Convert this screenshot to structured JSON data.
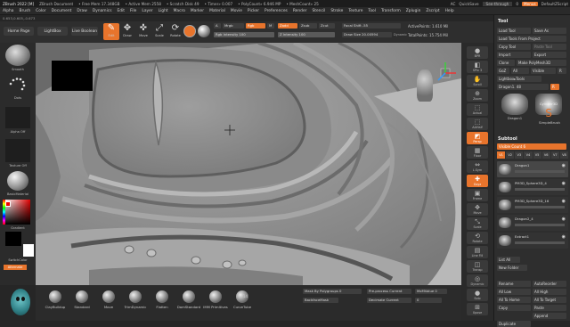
{
  "titlebar": {
    "app": "ZBrush 2022 [M]",
    "doc": "ZBrush Document",
    "free_mem": "• Free Mem 17.348GB",
    "active_mem": "• Active Mem 2558",
    "scratch": "• Scratch Disk 49",
    "timer": "• Timer» 0.007",
    "polycount": "• PolyCount» 6.946 MP",
    "meshcount": "• MeshCount» 25",
    "right": [
      "AC",
      "QuickSave",
      "See-through",
      "0",
      "Menus",
      "DefaultZScript"
    ]
  },
  "menubar": [
    "Alpha",
    "Brush",
    "Color",
    "Document",
    "Draw",
    "Dynamics",
    "Edit",
    "File",
    "Layer",
    "Light",
    "Macro",
    "Marker",
    "Material",
    "Movie",
    "Picker",
    "Preferences",
    "Render",
    "Stencil",
    "Stroke",
    "Texture",
    "Tool",
    "Transform",
    "Zplugin",
    "Zscript",
    "Help"
  ],
  "stats": "0.653,0.605,-0.673",
  "homebar": {
    "home_page": "Home Page",
    "lightbox": "LightBox",
    "live_boolean": "Live Boolean",
    "tools": [
      {
        "label": "Edit",
        "icon": "✎",
        "active": true
      },
      {
        "label": "Draw",
        "icon": "✥",
        "active": false
      },
      {
        "label": "Move",
        "icon": "✜",
        "active": false
      },
      {
        "label": "Scale",
        "icon": "⤢",
        "active": false
      },
      {
        "label": "Rotate",
        "icon": "⟳",
        "active": false
      }
    ],
    "a_label": "A",
    "mrgb": "Mrgb",
    "rgb": "Rgb",
    "m": "M",
    "rgb_intensity": "Rgb Intensity 100",
    "zadd": "Zadd",
    "zsub": "Zsub",
    "zcut": "Zcut",
    "z_intensity": "Z Intensity 100",
    "focal_shift": "Focal Shift -55",
    "draw_size": "Draw Size 20.00594",
    "dynamic": "Dynamic",
    "active_points": "ActivePoints: 1.610 Mil",
    "total_points": "TotalPoints: 15.754 Mil"
  },
  "leftpanel": {
    "brush": "Smooth",
    "stroke": "Dots",
    "alpha": "Alpha Off",
    "texture": "Texture Off",
    "material": "BasicMaterial",
    "gradient": "Gradient",
    "switch_color": "SwitchColor",
    "alternate": "Alternate"
  },
  "rightstrip": [
    {
      "label": "BPR",
      "icon": "●"
    },
    {
      "label": "SPix 3",
      "icon": "◧"
    },
    {
      "label": "Scroll",
      "icon": "✋"
    },
    {
      "label": "Zoom",
      "icon": "⊕"
    },
    {
      "label": "Actual",
      "icon": "⬚"
    },
    {
      "label": "AAHalf",
      "icon": "⬚"
    },
    {
      "label": "Persp",
      "icon": "◩",
      "on": true
    },
    {
      "label": "Floor",
      "icon": "▦"
    },
    {
      "label": "L.Sym",
      "icon": "⇔"
    },
    {
      "label": "Gxyz",
      "icon": "✚",
      "on": true
    },
    {
      "label": "Frame",
      "icon": "▣"
    },
    {
      "label": "Move",
      "icon": "✥"
    },
    {
      "label": "Scale",
      "icon": "⤡"
    },
    {
      "label": "Rotate",
      "icon": "⟲"
    },
    {
      "label": "Line Fill",
      "icon": "▤"
    },
    {
      "label": "Transp",
      "icon": "◫"
    },
    {
      "label": "Dynamic",
      "icon": "◎"
    },
    {
      "label": "Solo",
      "icon": "●"
    },
    {
      "label": "Xpose",
      "icon": "⊞"
    }
  ],
  "toolpanel": {
    "title": "Tool",
    "load_tool": "Load Tool",
    "save_as": "Save As",
    "load_tools_project": "Load Tools From Project",
    "copy_tool": "Copy Tool",
    "paste_tool": "Paste Tool",
    "import": "Import",
    "export": "Export",
    "clone": "Clone",
    "make_polymesh": "Make PolyMesh3D",
    "goz": "GoZ",
    "all": "All",
    "visible": "Visible",
    "r": "R",
    "lightbox_tools": "Lightbox▸Tools",
    "current_tool": "Dragon1. 48",
    "tools_grid": [
      "Dragon1",
      "SimpleBrush",
      "Dragon1",
      "Cylinder3D"
    ],
    "subtool_title": "Subtool",
    "visible_count": "Visible Count 6",
    "versions": [
      "V1",
      "V2",
      "V3",
      "V4",
      "V5",
      "V6",
      "V7",
      "V8"
    ],
    "subtools": [
      "Dragon1",
      "PM3D_Sphere3D_4",
      "PM3D_Sphere3D_16",
      "Dragon2_4",
      "Extract1"
    ],
    "list_all": "List All",
    "new_folder": "New Folder",
    "rename": "Rename",
    "auto_reorder": "AutoReorder",
    "all_low": "All Low",
    "all_high": "All High",
    "all_to_home": "All To Home",
    "all_to_target": "All To Target",
    "copy": "Copy",
    "paste": "Paste",
    "append": "Append",
    "duplicate": "Duplicate"
  },
  "bottombar": {
    "brushes": [
      "ClayBuildup",
      "Standard",
      "Move",
      "TrimDynamic",
      "Flatten",
      "DamStandard",
      "IMM Primitives",
      "CurveTube"
    ],
    "imm_count": "14",
    "mask_label": "Mask By Polygroups 0",
    "backface": "BackfaceMask",
    "preprocess": "Pre-process Current",
    "decimate": "Decimate Current",
    "max_value": "MxMValue 0",
    "zremesher_val": "0"
  },
  "colors": {
    "accent": "#e8742c",
    "panel": "#2b2b2b",
    "viewport": "#8f8f8f"
  }
}
